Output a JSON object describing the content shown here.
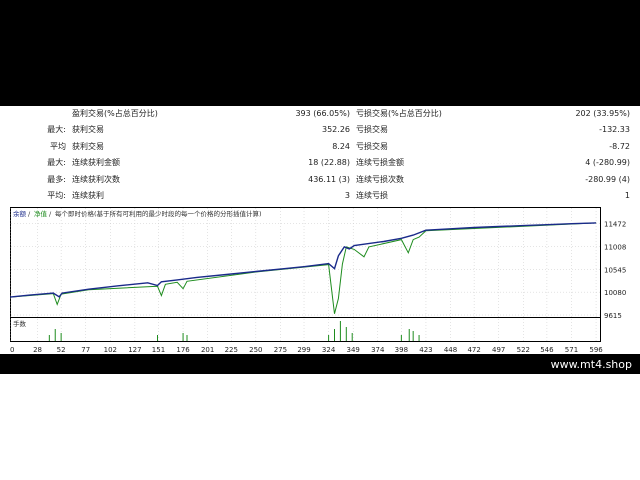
{
  "stats": {
    "rows": [
      {
        "p1": "",
        "l1": "盈利交易(%占总百分比)",
        "v1": "393 (66.05%)",
        "l2": "亏损交易(%占总百分比)",
        "v2": "202 (33.95%)"
      },
      {
        "p1": "最大:",
        "l1": "获利交易",
        "v1": "352.26",
        "l2": "亏损交易",
        "v2": "-132.33"
      },
      {
        "p1": "平均",
        "l1": "获利交易",
        "v1": "8.24",
        "l2": "亏损交易",
        "v2": "-8.72"
      },
      {
        "p1": "最大:",
        "l1": "连续获利金额",
        "v1": "18 (22.88)",
        "l2": "连续亏损金额",
        "v2": "4 (-280.99)"
      },
      {
        "p1": "最多:",
        "l1": "连续获利次数",
        "v1": "436.11 (3)",
        "l2": "连续亏损次数",
        "v2": "-280.99 (4)"
      },
      {
        "p1": "平均:",
        "l1": "连续获利",
        "v1": "3",
        "l2": "连续亏损",
        "v2": "1"
      }
    ]
  },
  "chart_header": {
    "legend_balance": "余额",
    "legend_equity": "净值",
    "description": "每个即时价格(基于所有可利用的最少时段的每一个价格的分形插值计算)"
  },
  "volume_label": "手数",
  "site_label": "www.mt4.shop",
  "colors": {
    "balance": "#1a2a8a",
    "equity": "#1e8c1e",
    "volume": "#1e8c1e",
    "grid": "#c8c8c8"
  },
  "chart_data": {
    "type": "line",
    "title": "",
    "xlabel": "",
    "ylabel": "",
    "ylim": [
      9615,
      11650
    ],
    "y_ticks": [
      9615,
      10080,
      10545,
      11008,
      11472
    ],
    "x_ticks": [
      0,
      28,
      52,
      77,
      102,
      127,
      151,
      176,
      201,
      225,
      250,
      275,
      299,
      324,
      349,
      374,
      398,
      423,
      448,
      472,
      497,
      522,
      546,
      571,
      596
    ],
    "series": [
      {
        "name": "余额",
        "points": [
          [
            0,
            9980
          ],
          [
            20,
            10020
          ],
          [
            44,
            10060
          ],
          [
            50,
            9985
          ],
          [
            53,
            10060
          ],
          [
            80,
            10140
          ],
          [
            110,
            10210
          ],
          [
            140,
            10270
          ],
          [
            150,
            10215
          ],
          [
            154,
            10290
          ],
          [
            170,
            10330
          ],
          [
            190,
            10380
          ],
          [
            220,
            10440
          ],
          [
            250,
            10500
          ],
          [
            280,
            10560
          ],
          [
            300,
            10600
          ],
          [
            324,
            10660
          ],
          [
            330,
            10560
          ],
          [
            334,
            10820
          ],
          [
            340,
            11000
          ],
          [
            345,
            10960
          ],
          [
            350,
            11030
          ],
          [
            380,
            11110
          ],
          [
            398,
            11175
          ],
          [
            410,
            11240
          ],
          [
            423,
            11340
          ],
          [
            448,
            11370
          ],
          [
            472,
            11395
          ],
          [
            497,
            11415
          ],
          [
            522,
            11435
          ],
          [
            546,
            11452
          ],
          [
            571,
            11472
          ],
          [
            596,
            11490
          ]
        ]
      },
      {
        "name": "净值",
        "points": [
          [
            0,
            9980
          ],
          [
            44,
            10050
          ],
          [
            48,
            9830
          ],
          [
            52,
            10040
          ],
          [
            80,
            10130
          ],
          [
            150,
            10200
          ],
          [
            154,
            10010
          ],
          [
            158,
            10240
          ],
          [
            170,
            10280
          ],
          [
            176,
            10150
          ],
          [
            180,
            10300
          ],
          [
            250,
            10490
          ],
          [
            324,
            10640
          ],
          [
            330,
            9640
          ],
          [
            334,
            9950
          ],
          [
            338,
            10650
          ],
          [
            342,
            11000
          ],
          [
            350,
            10950
          ],
          [
            360,
            10800
          ],
          [
            365,
            11000
          ],
          [
            398,
            11150
          ],
          [
            405,
            10880
          ],
          [
            410,
            11150
          ],
          [
            416,
            11200
          ],
          [
            423,
            11330
          ],
          [
            596,
            11490
          ]
        ]
      }
    ],
    "volume": {
      "label": "手数",
      "bars": [
        [
          40,
          3
        ],
        [
          46,
          6
        ],
        [
          52,
          4
        ],
        [
          150,
          3
        ],
        [
          176,
          4
        ],
        [
          180,
          3
        ],
        [
          324,
          3
        ],
        [
          330,
          6
        ],
        [
          336,
          10
        ],
        [
          342,
          7
        ],
        [
          348,
          4
        ],
        [
          398,
          3
        ],
        [
          406,
          6
        ],
        [
          410,
          5
        ],
        [
          416,
          3
        ]
      ]
    }
  }
}
